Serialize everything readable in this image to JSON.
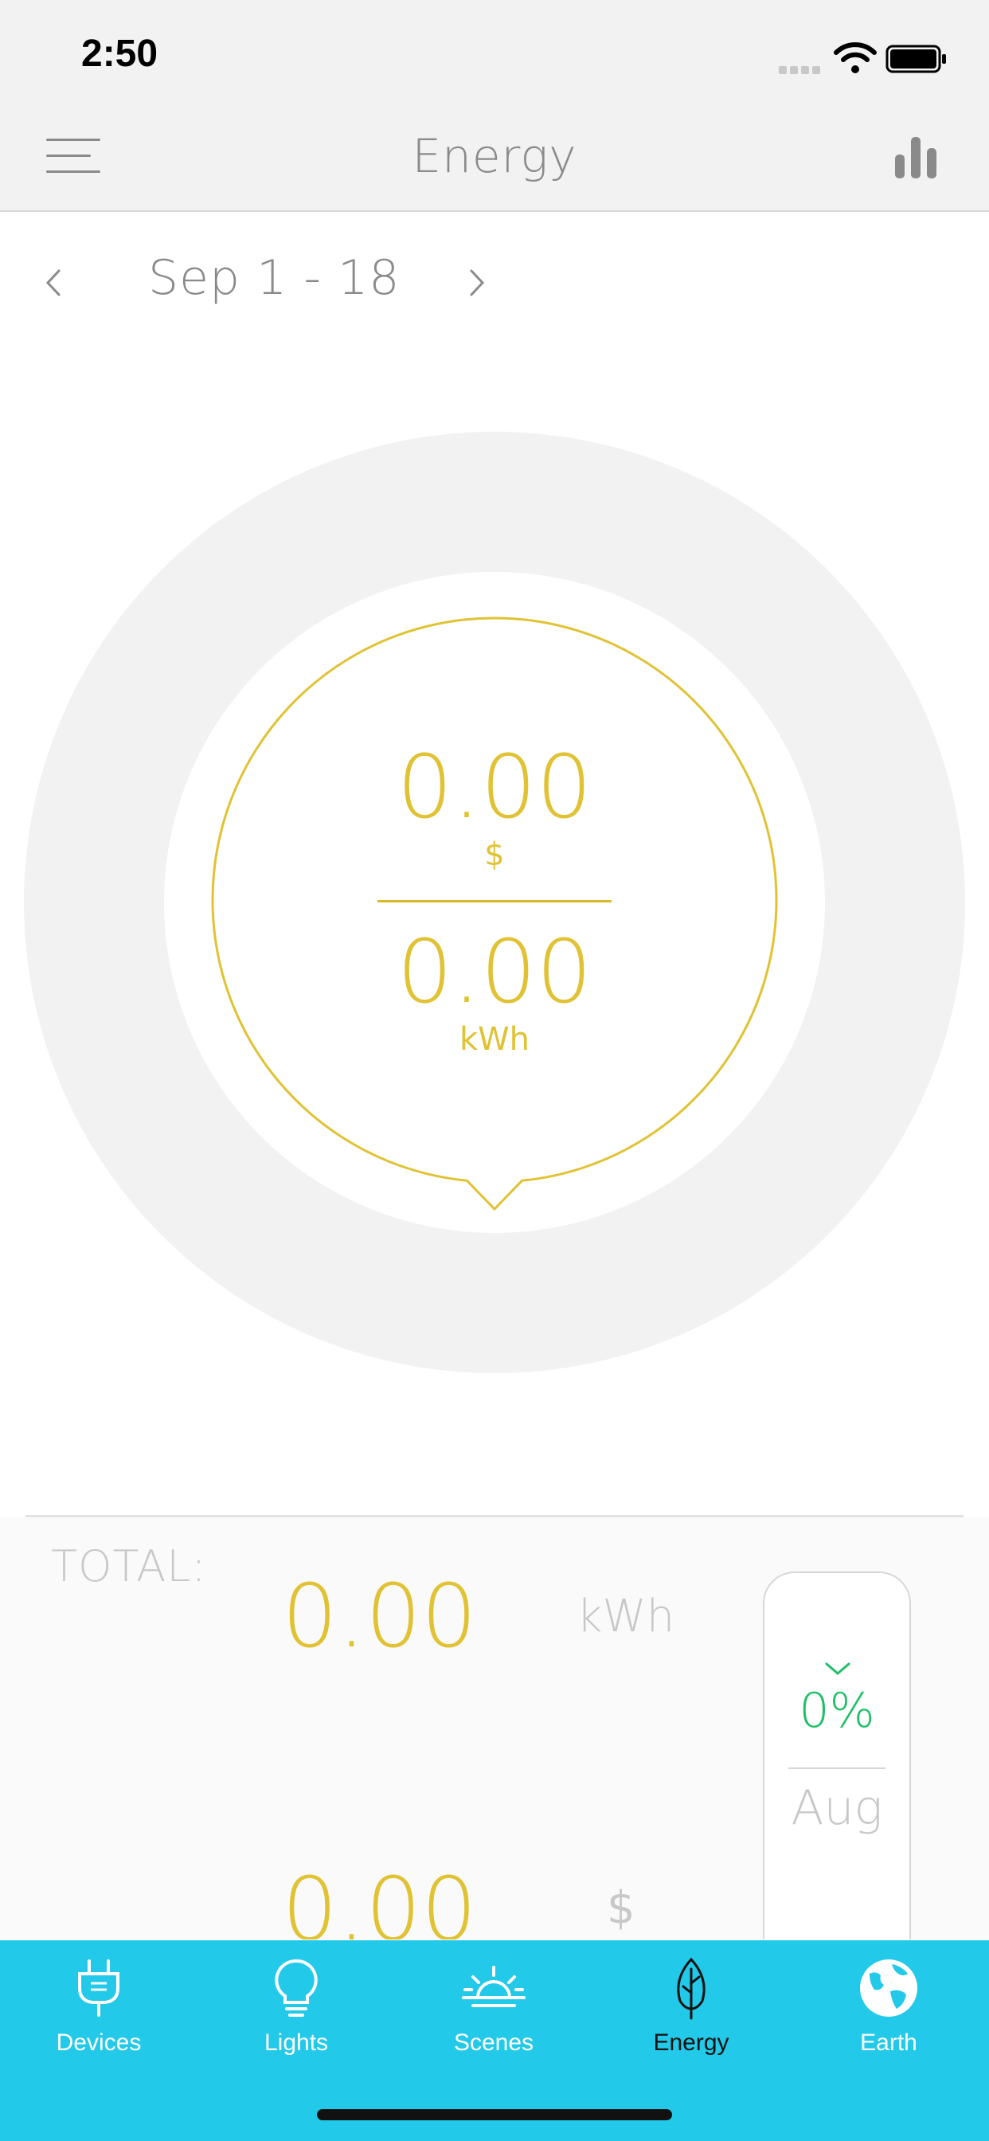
{
  "status_bar": {
    "time": "2:50"
  },
  "nav": {
    "title": "Energy"
  },
  "date_range": {
    "label": "Sep 1  - 18"
  },
  "gauge": {
    "cost_value": "0.00",
    "cost_unit": "$",
    "energy_value": "0.00",
    "energy_unit": "kWh"
  },
  "total": {
    "label": "TOTAL:",
    "energy_value": "0.00",
    "energy_unit": "kWh",
    "cost_value": "0.00",
    "cost_unit": "$"
  },
  "comparison": {
    "percent": "0%",
    "month": "Aug"
  },
  "tabs": [
    {
      "label": "Devices",
      "icon": "plug-icon"
    },
    {
      "label": "Lights",
      "icon": "bulb-icon"
    },
    {
      "label": "Scenes",
      "icon": "sunrise-icon"
    },
    {
      "label": "Energy",
      "icon": "leaf-icon",
      "active": true
    },
    {
      "label": "Earth",
      "icon": "globe-icon"
    }
  ],
  "colors": {
    "accent": "#e0c234",
    "tab_bar": "#22c9e8",
    "positive": "#1fbf67",
    "muted": "#8a8a8a"
  }
}
